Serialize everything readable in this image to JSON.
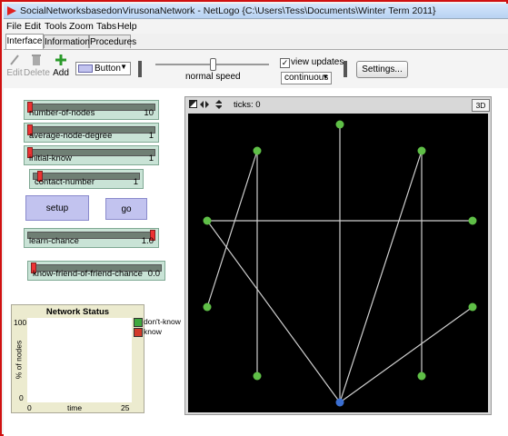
{
  "window": {
    "title": "SocialNetworksbasedonVirusonaNetwork - NetLogo {C:\\Users\\Tess\\Documents\\Winter Term 2011}"
  },
  "menu": [
    "File",
    "Edit",
    "Tools",
    "Zoom",
    "Tabs",
    "Help"
  ],
  "tabs": [
    "Interface",
    "Information",
    "Procedures"
  ],
  "toolbar": {
    "edit_label": "Edit",
    "delete_label": "Delete",
    "add_label": "Add",
    "widget_type": "Button",
    "speed_label": "normal speed",
    "view_updates_label": "view updates",
    "view_updates_checked": true,
    "update_mode": "continuous",
    "settings_label": "Settings..."
  },
  "sliders": {
    "number_of_nodes": {
      "label": "number-of-nodes",
      "value": "10"
    },
    "average_node_degree": {
      "label": "average-node-degree",
      "value": "1"
    },
    "initial_know": {
      "label": "initial-know",
      "value": "1"
    },
    "contact_number": {
      "label": "contact-number",
      "value": "1"
    },
    "learn_chance": {
      "label": "learn-chance",
      "value": "1.0"
    },
    "kofof_chance": {
      "label": "know-friend-of-friend-chance",
      "value": "0.0"
    }
  },
  "buttons": {
    "setup": "setup",
    "go": "go"
  },
  "plot": {
    "title": "Network Status",
    "ylabel": "% of nodes",
    "xlabel": "time",
    "y_max_label": "100",
    "y_min_label": "0",
    "x_min_label": "0",
    "x_max_label": "25",
    "legend": [
      {
        "name": "don't-know",
        "color": "#3fa83f"
      },
      {
        "name": "know",
        "color": "#d23a2a"
      }
    ]
  },
  "view": {
    "ticks_label": "ticks: 0",
    "threed_label": "3D",
    "node_color_green": "#5fbf47",
    "node_color_blue": "#3b6fd1",
    "link_color": "#cfcfcf"
  }
}
